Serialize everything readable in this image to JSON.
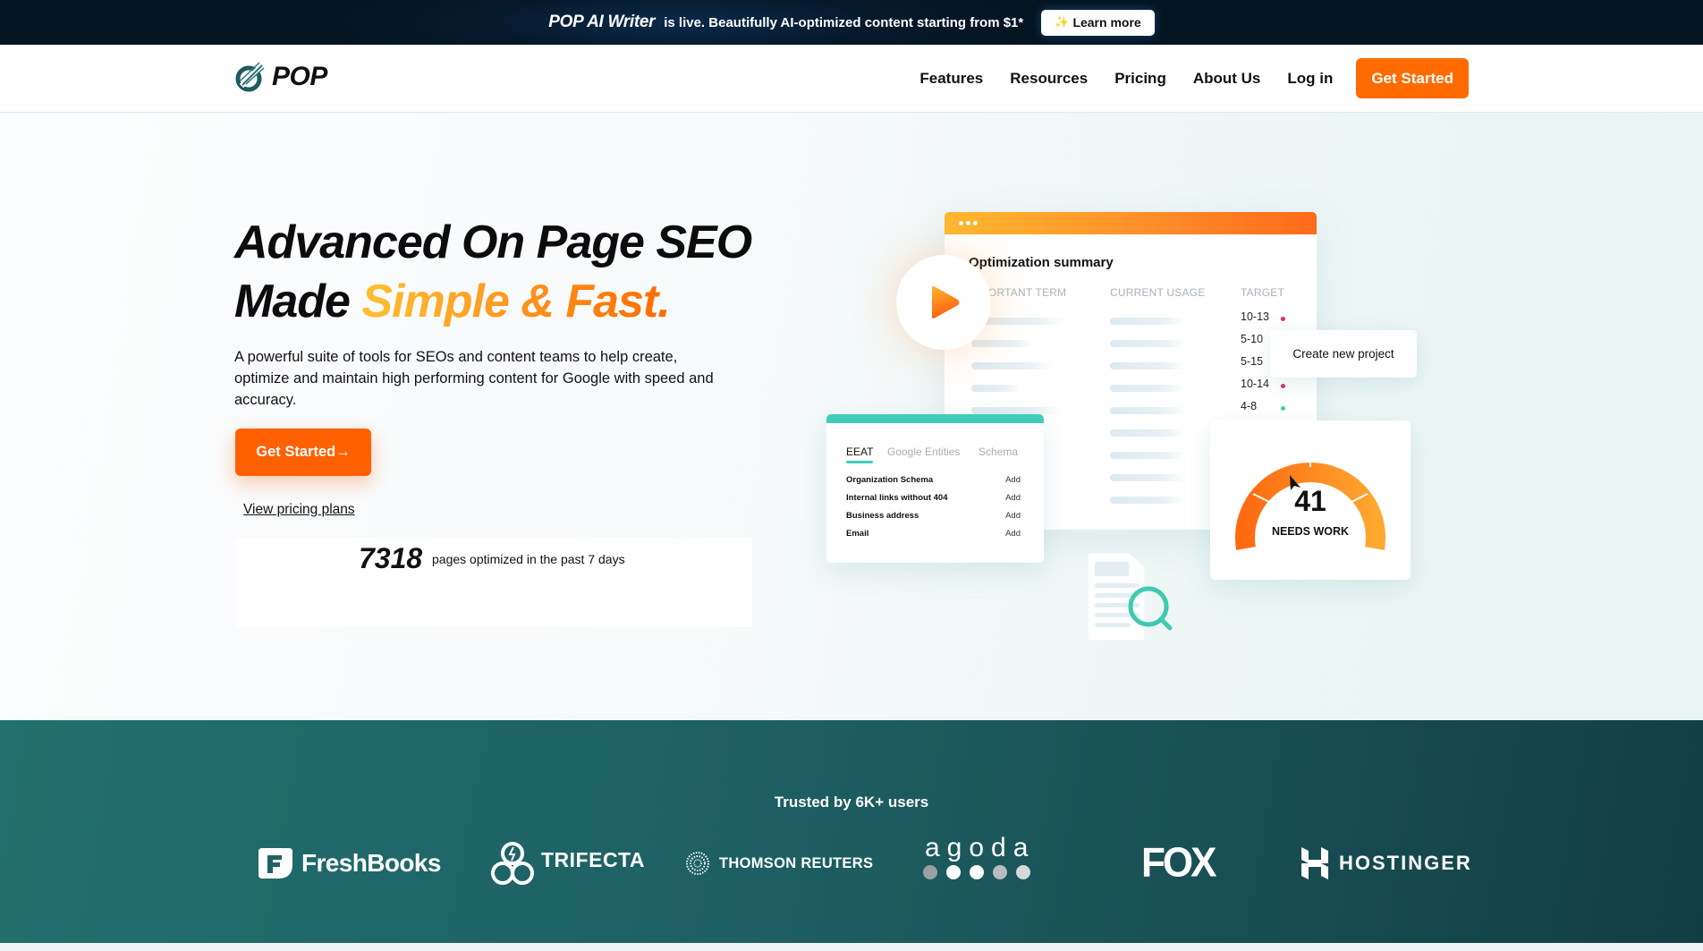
{
  "announcement": {
    "brand": "POP AI Writer",
    "message": "is live. Beautifully AI-optimized content starting from $1*",
    "cta_label": "Learn more",
    "cta_icon": "sparkles-icon"
  },
  "nav": {
    "logo_text": "POP",
    "links": [
      {
        "label": "Features"
      },
      {
        "label": "Resources"
      },
      {
        "label": "Pricing"
      },
      {
        "label": "About Us"
      },
      {
        "label": "Log in"
      }
    ],
    "cta_label": "Get Started"
  },
  "hero": {
    "title_line1": "Advanced On Page SEO",
    "title_line2_plain": "Made ",
    "title_line2_highlight": "Simple & Fast.",
    "description": "A powerful suite of tools for SEOs and content teams to help create, optimize and maintain high performing content for Google with speed and accuracy.",
    "cta_label": "Get Started",
    "cta_arrow": "→",
    "pricing_link": "View pricing plans",
    "stat_number": "7318",
    "stat_text": "pages optimized in the past 7 days"
  },
  "illustration": {
    "summary_title": "Optimization summary",
    "columns": [
      "IMPORTANT TERM",
      "CURRENT USAGE",
      "TARGET"
    ],
    "targets": [
      {
        "range": "10-13",
        "status": "red"
      },
      {
        "range": "5-10",
        "status": "none"
      },
      {
        "range": "5-15",
        "status": "none"
      },
      {
        "range": "10-14",
        "status": "red"
      },
      {
        "range": "4-8",
        "status": "green"
      }
    ],
    "create_project_label": "Create new project",
    "eeat_tabs": [
      "EEAT",
      "Google Entities",
      "Schema"
    ],
    "eeat_rows": [
      {
        "label": "Organization Schema",
        "action": "Add"
      },
      {
        "label": "Internal links without 404",
        "action": "Add"
      },
      {
        "label": "Business address",
        "action": "Add"
      },
      {
        "label": "Email",
        "action": "Add"
      }
    ],
    "score": "41",
    "score_label": "NEEDS WORK",
    "colors": {
      "red": "#f0285a",
      "green": "#3fcfb4",
      "orange": "#ff6b00",
      "teal": "#41cdb8"
    }
  },
  "trusted": {
    "heading": "Trusted by 6K+ users",
    "logos": [
      "FreshBooks",
      "TRIFECTA",
      "THOMSON REUTERS",
      "agoda",
      "FOX",
      "HOSTINGER"
    ]
  }
}
